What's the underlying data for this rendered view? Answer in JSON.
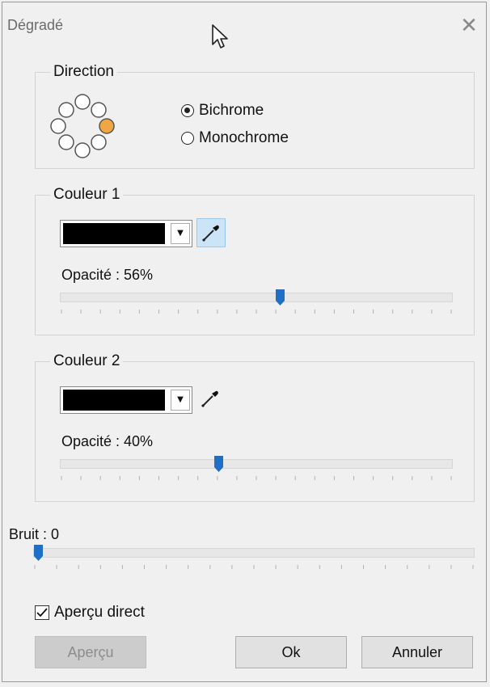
{
  "window": {
    "title": "Dégradé"
  },
  "direction": {
    "title": "Direction",
    "options": [
      {
        "label": "Bichrome",
        "selected": true
      },
      {
        "label": "Monochrome",
        "selected": false
      }
    ],
    "selected_circle_color": "#f0a643"
  },
  "color1": {
    "title": "Couleur 1",
    "swatch_color": "#000000",
    "opacity_label": "Opacité : 56%",
    "opacity_value": 56
  },
  "color2": {
    "title": "Couleur 2",
    "swatch_color": "#000000",
    "opacity_label": "Opacité : 40%",
    "opacity_value": 40
  },
  "noise": {
    "label": "Bruit : 0",
    "value": 0
  },
  "live_preview": {
    "label": "Aperçu direct",
    "checked": true
  },
  "buttons": {
    "preview": "Aperçu",
    "ok": "Ok",
    "cancel": "Annuler"
  },
  "accent_color": "#1f6fc7"
}
